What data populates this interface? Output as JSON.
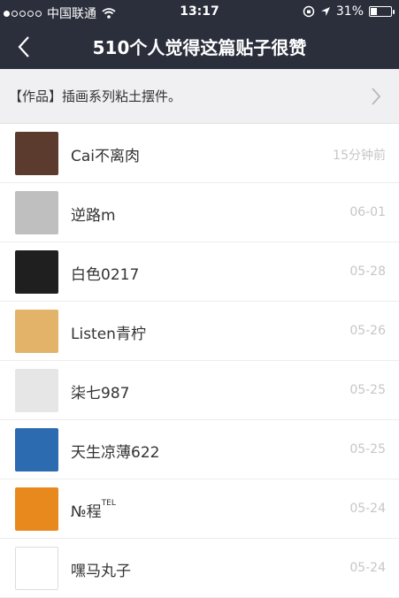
{
  "status_bar": {
    "carrier": "中国联通",
    "time": "13:17",
    "battery_text": "31%",
    "battery_level": 0.31
  },
  "nav": {
    "back_icon": "chevron-left-icon",
    "title": "510个人觉得这篇贴子很赞"
  },
  "post_link": {
    "label": "【作品】插画系列粘土摆件。"
  },
  "users": [
    {
      "name": "Cai不离肉",
      "date": "15分钟前",
      "avatar_color": "#5a3b2e"
    },
    {
      "name": "逆路m",
      "date": "06-01",
      "avatar_color": "#bfbfbf"
    },
    {
      "name": "白色0217",
      "date": "05-28",
      "avatar_color": "#1f1f1f"
    },
    {
      "name": "Listen青柠",
      "date": "05-26",
      "avatar_color": "#e3b36a"
    },
    {
      "name": "柒七987",
      "date": "05-25",
      "avatar_color": "#e6e6e6"
    },
    {
      "name": "天生凉薄622",
      "date": "05-25",
      "avatar_color": "#2c6bb0"
    },
    {
      "name": "№程",
      "name_sup": "TEL",
      "date": "05-24",
      "avatar_color": "#e8891e"
    },
    {
      "name": "嘿马丸子",
      "date": "05-24",
      "avatar_color": "#ffffff"
    }
  ]
}
